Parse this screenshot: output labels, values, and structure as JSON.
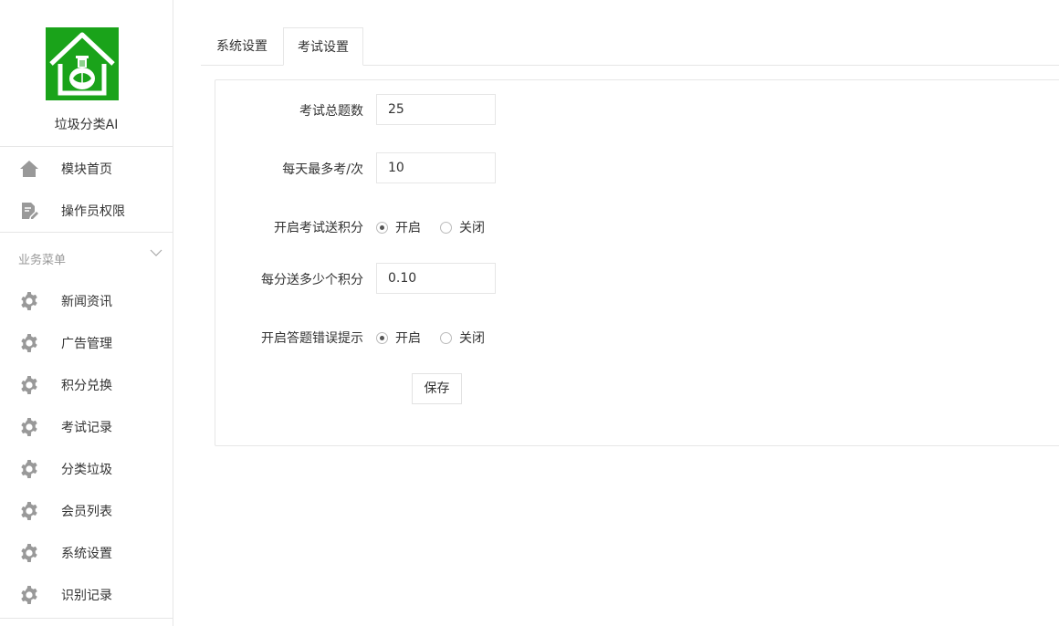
{
  "app": {
    "name": "垃圾分类AI",
    "brand_color": "#1aa31a"
  },
  "sidebar": {
    "top_items": [
      {
        "label": "模块首页",
        "icon": "home-icon"
      },
      {
        "label": "操作员权限",
        "icon": "edit-doc-icon"
      }
    ],
    "group": {
      "label": "业务菜单",
      "icon": "chevron-down-icon"
    },
    "items": [
      {
        "label": "新闻资讯",
        "icon": "gear-icon"
      },
      {
        "label": "广告管理",
        "icon": "gear-icon"
      },
      {
        "label": "积分兑换",
        "icon": "gear-icon"
      },
      {
        "label": "考试记录",
        "icon": "gear-icon"
      },
      {
        "label": "分类垃圾",
        "icon": "gear-icon"
      },
      {
        "label": "会员列表",
        "icon": "gear-icon"
      },
      {
        "label": "系统设置",
        "icon": "gear-icon"
      },
      {
        "label": "识别记录",
        "icon": "gear-icon"
      }
    ]
  },
  "tabs": [
    {
      "label": "系统设置",
      "active": false
    },
    {
      "label": "考试设置",
      "active": true
    }
  ],
  "form": {
    "total_questions": {
      "label": "考试总题数",
      "value": "25"
    },
    "max_per_day": {
      "label": "每天最多考/次",
      "value": "10"
    },
    "exam_points": {
      "label": "开启考试送积分",
      "on_label": "开启",
      "off_label": "关闭",
      "selected": "开启"
    },
    "points_per_score": {
      "label": "每分送多少个积分",
      "value": "0.10"
    },
    "wrong_hint": {
      "label": "开启答题错误提示",
      "on_label": "开启",
      "off_label": "关闭",
      "selected": "开启"
    },
    "save_label": "保存"
  }
}
